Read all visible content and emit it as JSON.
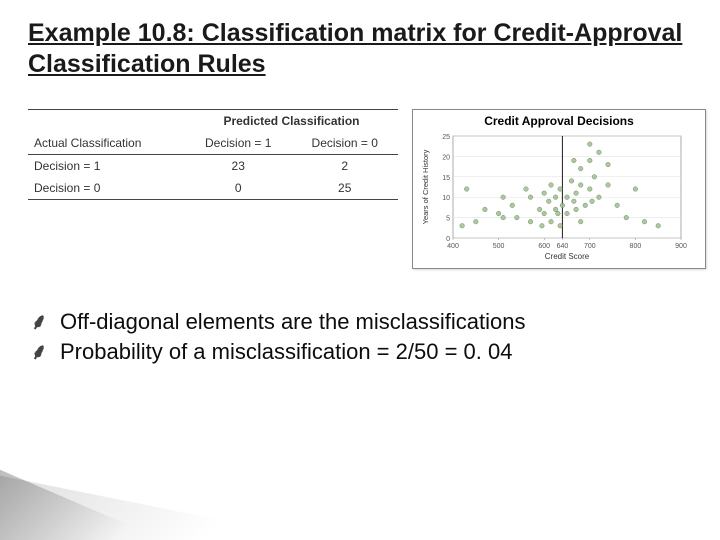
{
  "title": "Example 10.8: Classification matrix for Credit-Approval Classification Rules",
  "table": {
    "group_header": "Predicted Classification",
    "actual_header": "Actual Classification",
    "col1": "Decision = 1",
    "col0": "Decision = 0",
    "row1_label": "Decision = 1",
    "row1_c1": "23",
    "row1_c0": "2",
    "row0_label": "Decision = 0",
    "row0_c1": "0",
    "row0_c0": "25"
  },
  "chart_data": {
    "type": "scatter",
    "title": "Credit Approval Decisions",
    "xlabel": "Credit Score",
    "ylabel": "Years of Credit History",
    "xlim": [
      400,
      900
    ],
    "ylim": [
      0,
      25
    ],
    "x_ticks": [
      400,
      500,
      600,
      640,
      700,
      800,
      900
    ],
    "y_ticks": [
      0,
      5,
      10,
      15,
      20,
      25
    ],
    "vline_x": 640,
    "series": [
      {
        "name": "points",
        "values": [
          {
            "x": 420,
            "y": 3
          },
          {
            "x": 430,
            "y": 12
          },
          {
            "x": 450,
            "y": 4
          },
          {
            "x": 470,
            "y": 7
          },
          {
            "x": 500,
            "y": 6
          },
          {
            "x": 510,
            "y": 5
          },
          {
            "x": 510,
            "y": 10
          },
          {
            "x": 530,
            "y": 8
          },
          {
            "x": 540,
            "y": 5
          },
          {
            "x": 560,
            "y": 12
          },
          {
            "x": 570,
            "y": 4
          },
          {
            "x": 570,
            "y": 10
          },
          {
            "x": 590,
            "y": 7
          },
          {
            "x": 595,
            "y": 3
          },
          {
            "x": 600,
            "y": 6
          },
          {
            "x": 600,
            "y": 11
          },
          {
            "x": 610,
            "y": 9
          },
          {
            "x": 615,
            "y": 4
          },
          {
            "x": 615,
            "y": 13
          },
          {
            "x": 625,
            "y": 7
          },
          {
            "x": 625,
            "y": 10
          },
          {
            "x": 630,
            "y": 6
          },
          {
            "x": 635,
            "y": 3
          },
          {
            "x": 635,
            "y": 12
          },
          {
            "x": 640,
            "y": 8
          },
          {
            "x": 650,
            "y": 6
          },
          {
            "x": 650,
            "y": 10
          },
          {
            "x": 660,
            "y": 14
          },
          {
            "x": 665,
            "y": 9
          },
          {
            "x": 665,
            "y": 19
          },
          {
            "x": 670,
            "y": 11
          },
          {
            "x": 670,
            "y": 7
          },
          {
            "x": 680,
            "y": 17
          },
          {
            "x": 680,
            "y": 13
          },
          {
            "x": 680,
            "y": 4
          },
          {
            "x": 690,
            "y": 8
          },
          {
            "x": 700,
            "y": 23
          },
          {
            "x": 700,
            "y": 12
          },
          {
            "x": 700,
            "y": 19
          },
          {
            "x": 705,
            "y": 9
          },
          {
            "x": 710,
            "y": 15
          },
          {
            "x": 720,
            "y": 21
          },
          {
            "x": 720,
            "y": 10
          },
          {
            "x": 740,
            "y": 13
          },
          {
            "x": 740,
            "y": 18
          },
          {
            "x": 760,
            "y": 8
          },
          {
            "x": 780,
            "y": 5
          },
          {
            "x": 800,
            "y": 12
          },
          {
            "x": 820,
            "y": 4
          },
          {
            "x": 850,
            "y": 3
          }
        ]
      }
    ]
  },
  "bullets": {
    "b1": "Off-diagonal elements are the misclassifications",
    "b2": "Probability of a misclassification = 2/50 = 0. 04"
  }
}
